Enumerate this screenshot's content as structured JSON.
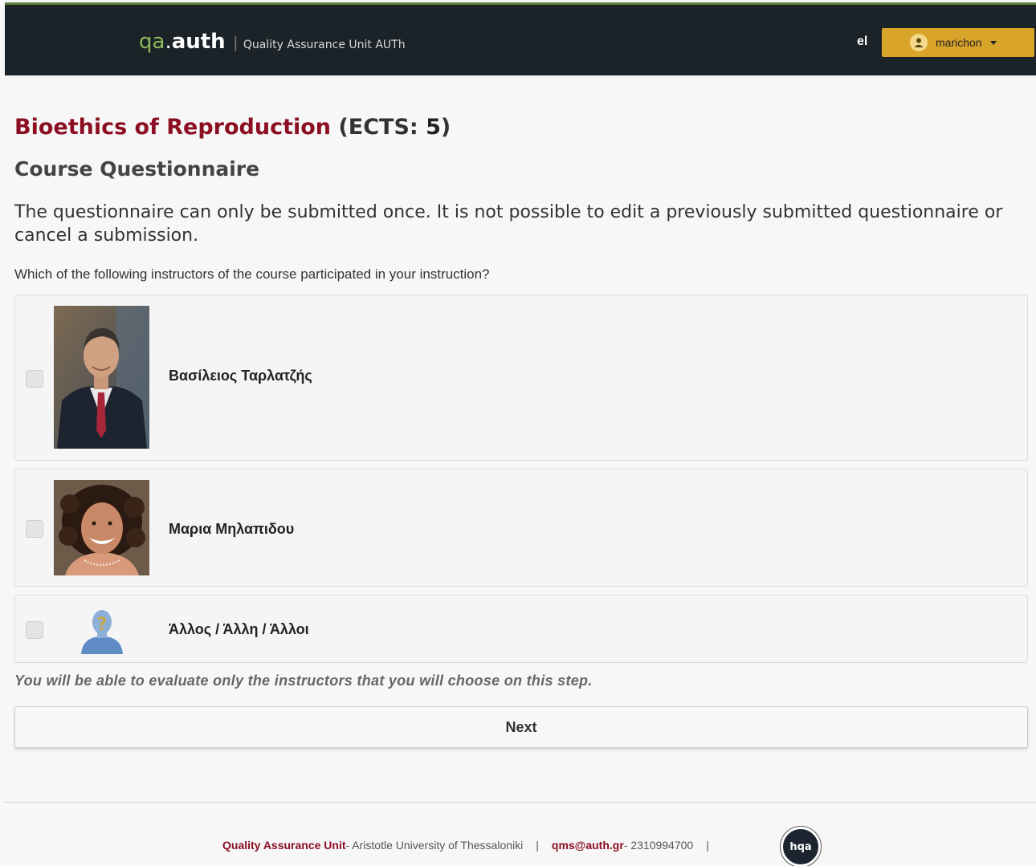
{
  "header": {
    "brand_qa": "qa",
    "brand_dot": ".",
    "brand_auth": "auth",
    "brand_sep": "|",
    "brand_subtitle": "Quality Assurance Unit AUTh",
    "language": "el",
    "username": "marichon"
  },
  "course": {
    "name": "Bioethics of Reproduction",
    "ects_prefix": "(ECTS: ",
    "ects_value": "5",
    "ects_suffix": ")"
  },
  "page": {
    "subtitle": "Course Questionnaire",
    "notice": "The questionnaire can only be submitted once. It is not possible to edit a previously submitted questionnaire or cancel a submission.",
    "question": "Which of the following instructors of the course participated in your instruction?"
  },
  "instructors": [
    {
      "name": "Βασίλειος Ταρλατζής",
      "checked": false,
      "photo": "portrait-man-suit"
    },
    {
      "name": "Μαρια Μηλαπιδου",
      "checked": false,
      "photo": "portrait-woman-curly-hair"
    },
    {
      "name": "Άλλος / Άλλη / Άλλοι",
      "checked": false,
      "photo": "unknown-person-icon"
    }
  ],
  "hint": "You will be able to evaluate only the instructors that you will choose on this step.",
  "buttons": {
    "next": "Next"
  },
  "footer": {
    "unit": "Quality Assurance Unit",
    "university": " - Aristotle University of Thessaloniki",
    "separator": "|",
    "email": "qms@auth.gr",
    "phone": " - 2310994700",
    "logo_text": "hqa"
  },
  "colors": {
    "topbar": "#1b2329",
    "brand_green": "#8bb95a",
    "user_button": "#d9a42a",
    "course_title": "#8b0e22"
  }
}
